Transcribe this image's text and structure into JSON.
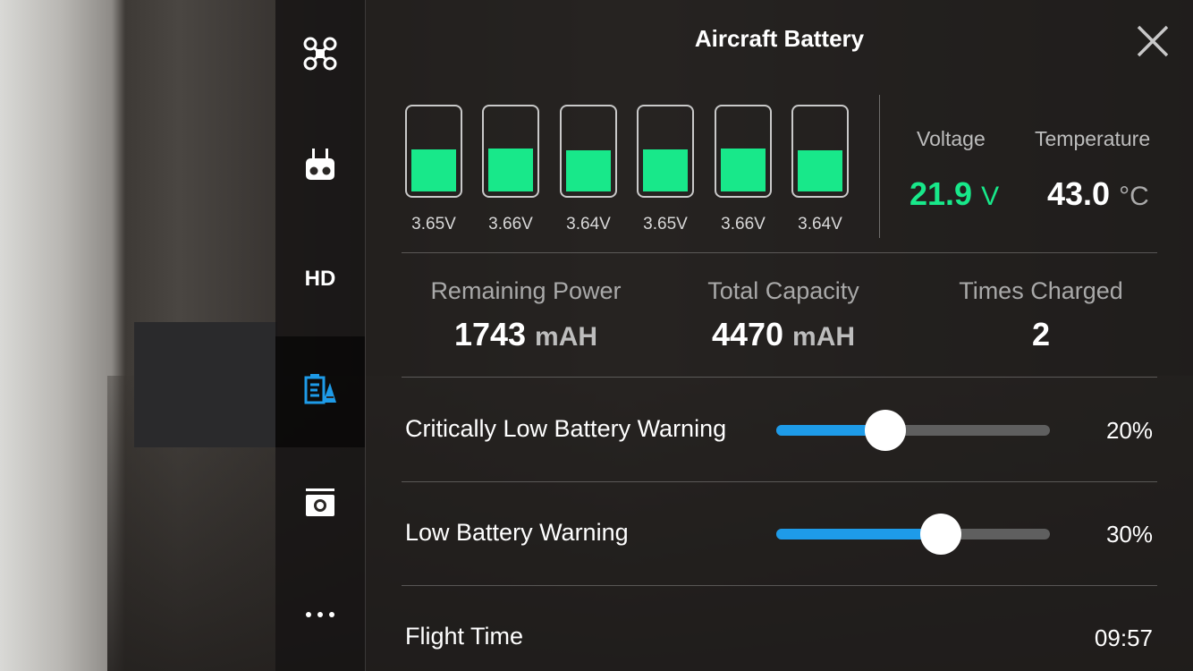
{
  "nav": {
    "items": [
      {
        "name": "aircraft",
        "icon": "drone-icon"
      },
      {
        "name": "remote-controller",
        "icon": "remote-controller-icon"
      },
      {
        "name": "hd-transmission",
        "label": "HD"
      },
      {
        "name": "battery",
        "icon": "battery-settings-icon",
        "active": true
      },
      {
        "name": "camera",
        "icon": "camera-icon"
      },
      {
        "name": "more",
        "icon": "more-dots-icon"
      }
    ]
  },
  "header": {
    "title": "Aircraft Battery",
    "close_icon": "close-icon"
  },
  "cells": [
    {
      "voltage": "3.65V",
      "level": 0.52
    },
    {
      "voltage": "3.66V",
      "level": 0.53
    },
    {
      "voltage": "3.64V",
      "level": 0.51
    },
    {
      "voltage": "3.65V",
      "level": 0.52
    },
    {
      "voltage": "3.66V",
      "level": 0.53
    },
    {
      "voltage": "3.64V",
      "level": 0.51
    }
  ],
  "voltage": {
    "label": "Voltage",
    "value": "21.9",
    "unit": "V"
  },
  "temperature": {
    "label": "Temperature",
    "value": "43.0",
    "unit": "°C"
  },
  "capacity": {
    "remaining": {
      "label": "Remaining Power",
      "value": "1743",
      "unit": "mAH"
    },
    "total": {
      "label": "Total Capacity",
      "value": "4470",
      "unit": "mAH"
    },
    "times_charged": {
      "label": "Times Charged",
      "value": "2"
    }
  },
  "critical_warning": {
    "label": "Critically Low Battery Warning",
    "value": "20%",
    "level": 0.2
  },
  "low_warning": {
    "label": "Low Battery Warning",
    "value": "30%",
    "level": 0.3
  },
  "flight_time": {
    "label": "Flight Time",
    "value": "09:57"
  },
  "colors": {
    "cell_fill": "#18e88a",
    "voltage_value": "#18e88a",
    "slider_fill": "#1e9be8"
  }
}
